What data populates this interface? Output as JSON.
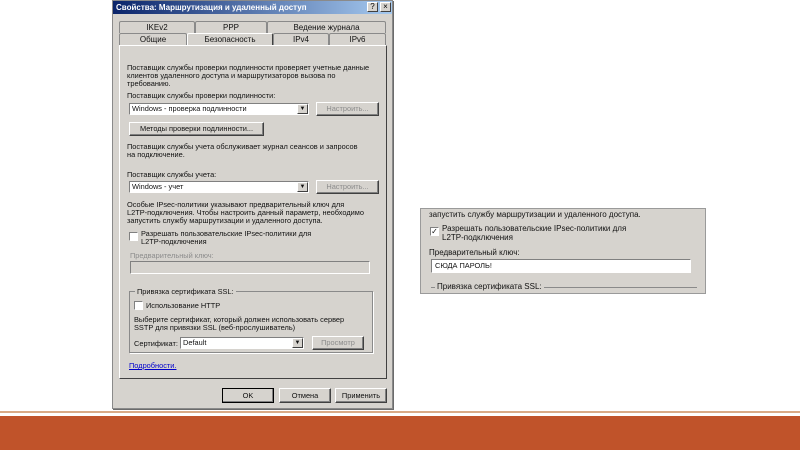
{
  "window": {
    "title": "Свойства: Маршрутизация и удаленный доступ",
    "help_glyph": "?",
    "close_glyph": "×"
  },
  "tabs_top": [
    "IKEv2",
    "PPP",
    "Ведение журнала"
  ],
  "tabs_bottom": [
    "Общие",
    "Безопасность",
    "IPv4",
    "IPv6"
  ],
  "security": {
    "auth_desc_1": "Поставщик службы проверки подлинности проверяет учетные данные",
    "auth_desc_2": "клиентов удаленного доступа и маршрутизаторов вызова по",
    "auth_desc_3": "требованию.",
    "auth_provider_label": "Поставщик службы проверки подлинности:",
    "auth_provider_value": "Windows - проверка подлинности",
    "configure_label": "Настроить...",
    "auth_methods_label": "Методы проверки подлинности...",
    "acct_desc_1": "Поставщик службы учета обслуживает журнал сеансов и запросов",
    "acct_desc_2": "на подключение.",
    "acct_provider_label": "Поставщик службы учета:",
    "acct_provider_value": "Windows - учет",
    "ipsec_desc_1": "Особые IPsec-политики указывают предварительный ключ для",
    "ipsec_desc_2": "L2TP-подключения.  Чтобы настроить данный параметр, необходимо",
    "ipsec_desc_3": "запустить службу маршрутизации и удаленного доступа.",
    "allow_ipsec_1": "Разрешать пользовательские IPsec-политики для",
    "allow_ipsec_2": "L2TP-подключения",
    "preshared_key_label": "Предварительный ключ:",
    "ssl_group_label": "Привязка сертификата SSL:",
    "use_http_label": "Использование HTTP",
    "cert_desc_1": "Выберите сертификат, который должен использовать сервер",
    "cert_desc_2": "SSTP для привязки SSL (веб-прослушиватель)",
    "cert_label": "Сертификат:",
    "cert_value": "Default",
    "view_label": "Просмотр",
    "details_link": "Подробности."
  },
  "buttons": {
    "ok": "OK",
    "cancel": "Отмена",
    "apply": "Применить"
  },
  "zoom": {
    "top_text": "запустить службу маршрутизации и удаленного доступа.",
    "allow_ipsec_1": "Разрешать пользовательские IPsec-политики для",
    "allow_ipsec_2": "L2TP-подключения",
    "check_glyph": "✓",
    "preshared_key_label": "Предварительный ключ:",
    "preshared_key_value": "СЮДА ПАРОЛЬ!",
    "ssl_group_label": "Привязка сертификата SSL:"
  },
  "colors": {
    "dialog_bg": "#d6d3ce",
    "footer_bar": "#c0532a",
    "footer_line": "#d9aa86"
  }
}
